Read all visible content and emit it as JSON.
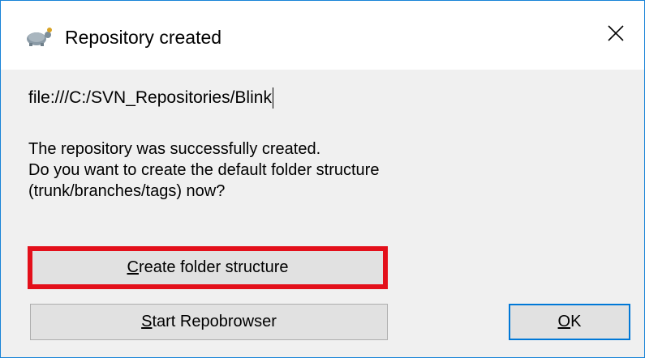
{
  "window": {
    "title": "Repository created",
    "icon": "tortoisesvn-turtle-icon",
    "close_icon": "close-icon"
  },
  "repository_path": "file:///C:/SVN_Repositories/Blink",
  "message": {
    "line1": "The repository was successfully created.",
    "line2": "Do you want to create the default folder structure",
    "line3": "(trunk/branches/tags) now?"
  },
  "buttons": {
    "create_folder_structure": {
      "accel": "C",
      "rest": "reate folder structure"
    },
    "start_repobrowser": {
      "accel": "S",
      "rest": "tart Repobrowser"
    },
    "ok": {
      "accel": "O",
      "rest": "K"
    }
  },
  "colors": {
    "highlight_border": "#e30f1a",
    "focus_border": "#0078d7",
    "window_border": "#1883d7"
  }
}
